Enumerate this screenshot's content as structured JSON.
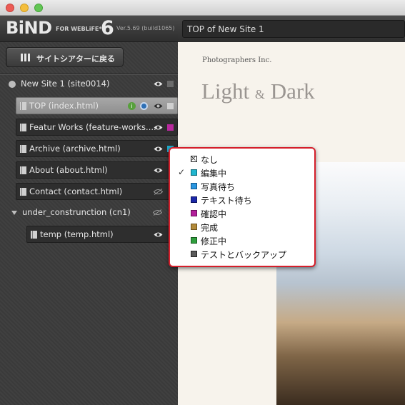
{
  "window": {
    "logo": "BiND",
    "logo_sub": "FOR WEBLiFE*",
    "logo_version_num": "6",
    "version": "Ver.5.69 (build1065)"
  },
  "back_button": {
    "label": "サイトシアターに戻る"
  },
  "site": {
    "label": "New Site 1 (site0014)"
  },
  "pages": [
    {
      "label": "TOP (index.html)",
      "selected": true,
      "status": "なし"
    },
    {
      "label": "Featur Works (feature-works....",
      "status": "確認中",
      "status_color": "#b8299e"
    },
    {
      "label": "Archive (archive.html)",
      "status": "編集中",
      "status_color": "#1fa9c9"
    },
    {
      "label": "About (about.html)"
    },
    {
      "label": "Contact (contact.html)"
    }
  ],
  "folder": {
    "label": "under_construnction (cn1)"
  },
  "sub_pages": [
    {
      "label": "temp (temp.html)"
    }
  ],
  "url": "TOP of New Site 1",
  "preview": {
    "company": "Photographers Inc.",
    "brand_left": "Light",
    "brand_amp": "&",
    "brand_right": "Dark"
  },
  "status_menu": {
    "items": [
      {
        "label": "なし",
        "color": "none",
        "checked": false
      },
      {
        "label": "編集中",
        "color": "#20b6cf",
        "checked": true
      },
      {
        "label": "写真待ち",
        "color": "#2a96e0",
        "checked": false
      },
      {
        "label": "テキスト待ち",
        "color": "#1b27a8",
        "checked": false
      },
      {
        "label": "確認中",
        "color": "#b21e9a",
        "checked": false
      },
      {
        "label": "完成",
        "color": "#b28a3a",
        "checked": false
      },
      {
        "label": "修正中",
        "color": "#2f9e3d",
        "checked": false
      },
      {
        "label": "テストとバックアップ",
        "color": "#5a5a5a",
        "checked": false
      }
    ]
  }
}
